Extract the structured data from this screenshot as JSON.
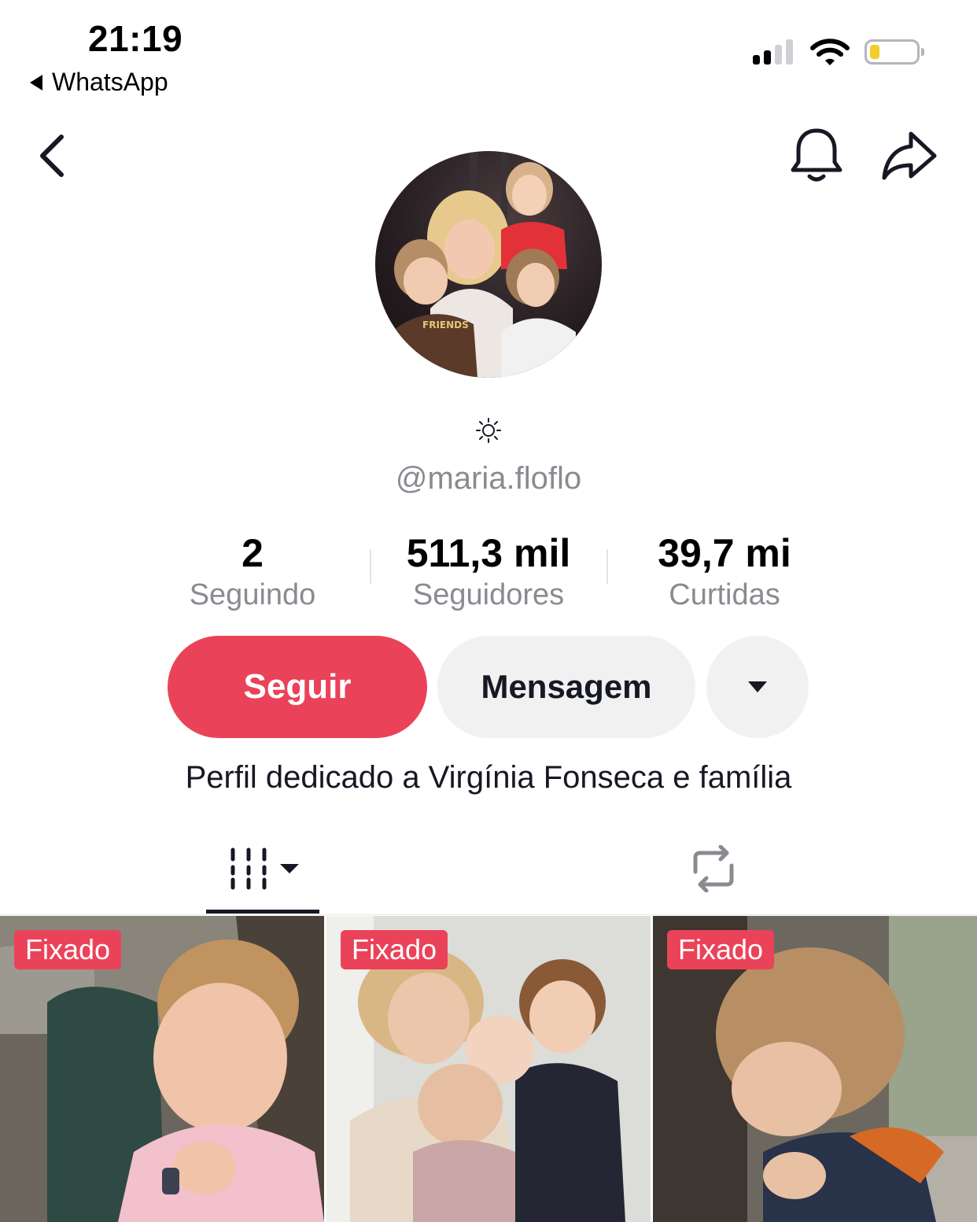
{
  "status_bar": {
    "time": "21:19",
    "back_app": "WhatsApp",
    "signal_bars": 2,
    "signal_bars_total": 4,
    "battery_level": 0.15
  },
  "nav": {
    "back_icon": "chevron-left-icon",
    "bell_icon": "bell-icon",
    "share_icon": "share-arrow-icon"
  },
  "profile": {
    "name_icon": "sun-icon",
    "username": "@maria.floflo",
    "bio": "Perfil dedicado a Virgínia Fonseca e família"
  },
  "stats": [
    {
      "value": "2",
      "label": "Seguindo"
    },
    {
      "value": "511,3 mil",
      "label": "Seguidores"
    },
    {
      "value": "39,7 mi",
      "label": "Curtidas"
    }
  ],
  "actions": {
    "follow": "Seguir",
    "message": "Mensagem",
    "more_icon": "caret-down-icon"
  },
  "tabs": {
    "videos_icon": "grid-bars-icon",
    "reposts_icon": "repost-icon"
  },
  "videos": [
    {
      "badge": "Fixado"
    },
    {
      "badge": "Fixado"
    },
    {
      "badge": "Fixado"
    }
  ],
  "colors": {
    "accent": "#ea4359",
    "secondary_button": "#f1f1f2",
    "muted_text": "#8a8b91",
    "battery": "#f4cd2a"
  }
}
